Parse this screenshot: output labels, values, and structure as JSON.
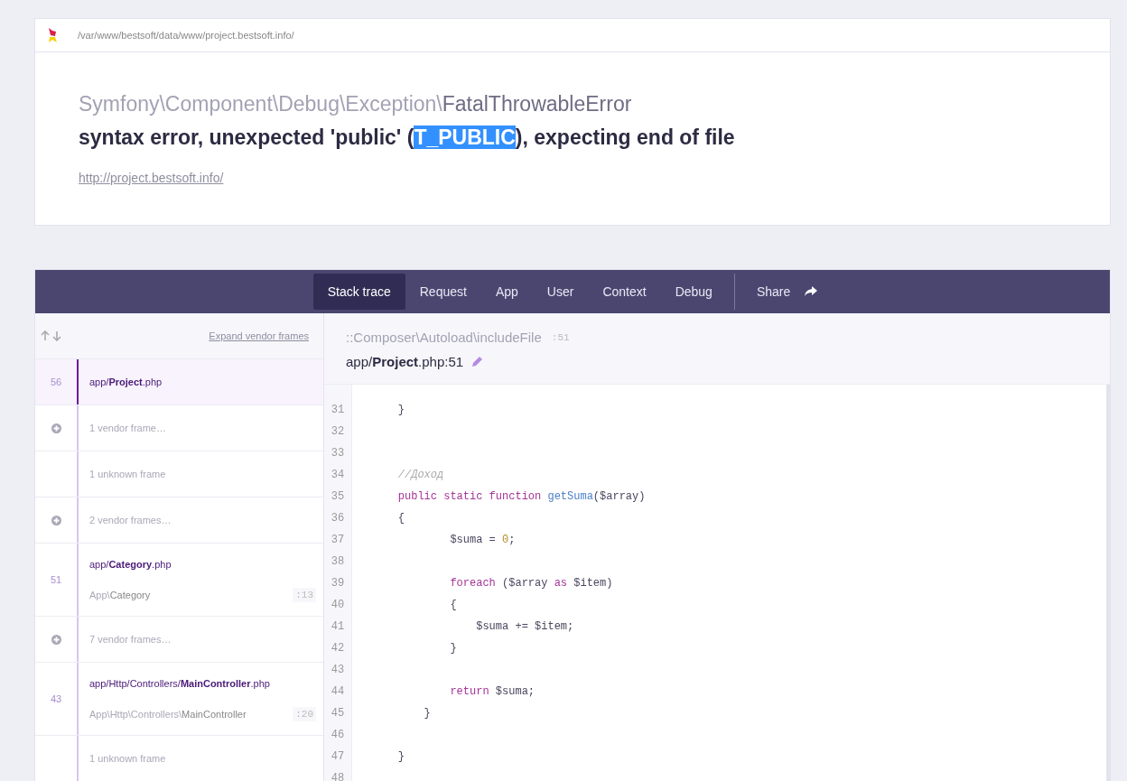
{
  "path": "/var/www/bestsoft/data/www/project.bestsoft.info/",
  "exception": {
    "namespace": "Symfony\\Component\\Debug\\Exception\\",
    "class": "FatalThrowableError"
  },
  "message": {
    "before": "syntax error, unexpected 'public' (",
    "selected": "T_PUBLIC",
    "after": "), expecting end of file"
  },
  "url": "http://project.bestsoft.info/",
  "tabs": [
    {
      "label": "Stack trace",
      "selected": true
    },
    {
      "label": "Request",
      "selected": false
    },
    {
      "label": "App",
      "selected": false
    },
    {
      "label": "User",
      "selected": false
    },
    {
      "label": "Context",
      "selected": false
    },
    {
      "label": "Debug",
      "selected": false
    }
  ],
  "share": {
    "label": "Share"
  },
  "frames_header": {
    "expand_link": "Expand vendor frames"
  },
  "frames": [
    {
      "kind": "app",
      "number": "56",
      "file": "app/**Project**.php",
      "selected": true
    },
    {
      "kind": "vendor",
      "text": "1 vendor frame…"
    },
    {
      "kind": "unknown",
      "text": "1 unknown frame"
    },
    {
      "kind": "vendor",
      "text": "2 vendor frames…"
    },
    {
      "kind": "app",
      "number": "51",
      "file": "app/**Category**.php",
      "namespace": "App\\",
      "class": "Category",
      "line": ":13",
      "selected": false
    },
    {
      "kind": "vendor",
      "text": "7 vendor frames…"
    },
    {
      "kind": "app",
      "number": "43",
      "file": "app/Http/Controllers/**MainController**.php",
      "namespace": "App\\Http\\Controllers\\",
      "class": "MainController",
      "line": ":20",
      "selected": false
    },
    {
      "kind": "unknown",
      "text": "1 unknown frame"
    }
  ],
  "frame_detail": {
    "method": "::Composer\\Autoload\\includeFile",
    "method_line": ":51",
    "file": "app/**Project**.php:51"
  },
  "code": [
    {
      "number": "31",
      "tokens": [
        {
          "kind": "plain",
          "text": "    }"
        }
      ]
    },
    {
      "number": "32"
    },
    {
      "number": "33"
    },
    {
      "number": "34",
      "tokens": [
        {
          "kind": "comment",
          "text": "    //Доход"
        }
      ]
    },
    {
      "number": "35",
      "tokens": [
        {
          "kind": "keyword",
          "text": "    public static function "
        },
        {
          "kind": "function",
          "text": "getSuma"
        },
        {
          "kind": "plain",
          "text": "($array)"
        }
      ]
    },
    {
      "number": "36",
      "tokens": [
        {
          "kind": "plain",
          "text": "    {"
        }
      ]
    },
    {
      "number": "37",
      "tokens": [
        {
          "kind": "plain",
          "text": "            $suma = "
        },
        {
          "kind": "number",
          "text": "0"
        },
        {
          "kind": "plain",
          "text": ";"
        }
      ]
    },
    {
      "number": "38"
    },
    {
      "number": "39",
      "tokens": [
        {
          "kind": "keyword",
          "text": "            foreach"
        },
        {
          "kind": "plain",
          "text": " ($array "
        },
        {
          "kind": "keyword",
          "text": "as"
        },
        {
          "kind": "plain",
          "text": " $item)"
        }
      ]
    },
    {
      "number": "40",
      "tokens": [
        {
          "kind": "plain",
          "text": "            {"
        }
      ]
    },
    {
      "number": "41",
      "tokens": [
        {
          "kind": "plain",
          "text": "                $suma += $item;"
        }
      ]
    },
    {
      "number": "42",
      "tokens": [
        {
          "kind": "plain",
          "text": "            }"
        }
      ]
    },
    {
      "number": "43"
    },
    {
      "number": "44",
      "tokens": [
        {
          "kind": "keyword",
          "text": "            return"
        },
        {
          "kind": "plain",
          "text": " $suma;"
        }
      ]
    },
    {
      "number": "45",
      "tokens": [
        {
          "kind": "plain",
          "text": "        }"
        }
      ]
    },
    {
      "number": "46"
    },
    {
      "number": "47",
      "tokens": [
        {
          "kind": "plain",
          "text": "    }"
        }
      ]
    },
    {
      "number": "48"
    }
  ]
}
